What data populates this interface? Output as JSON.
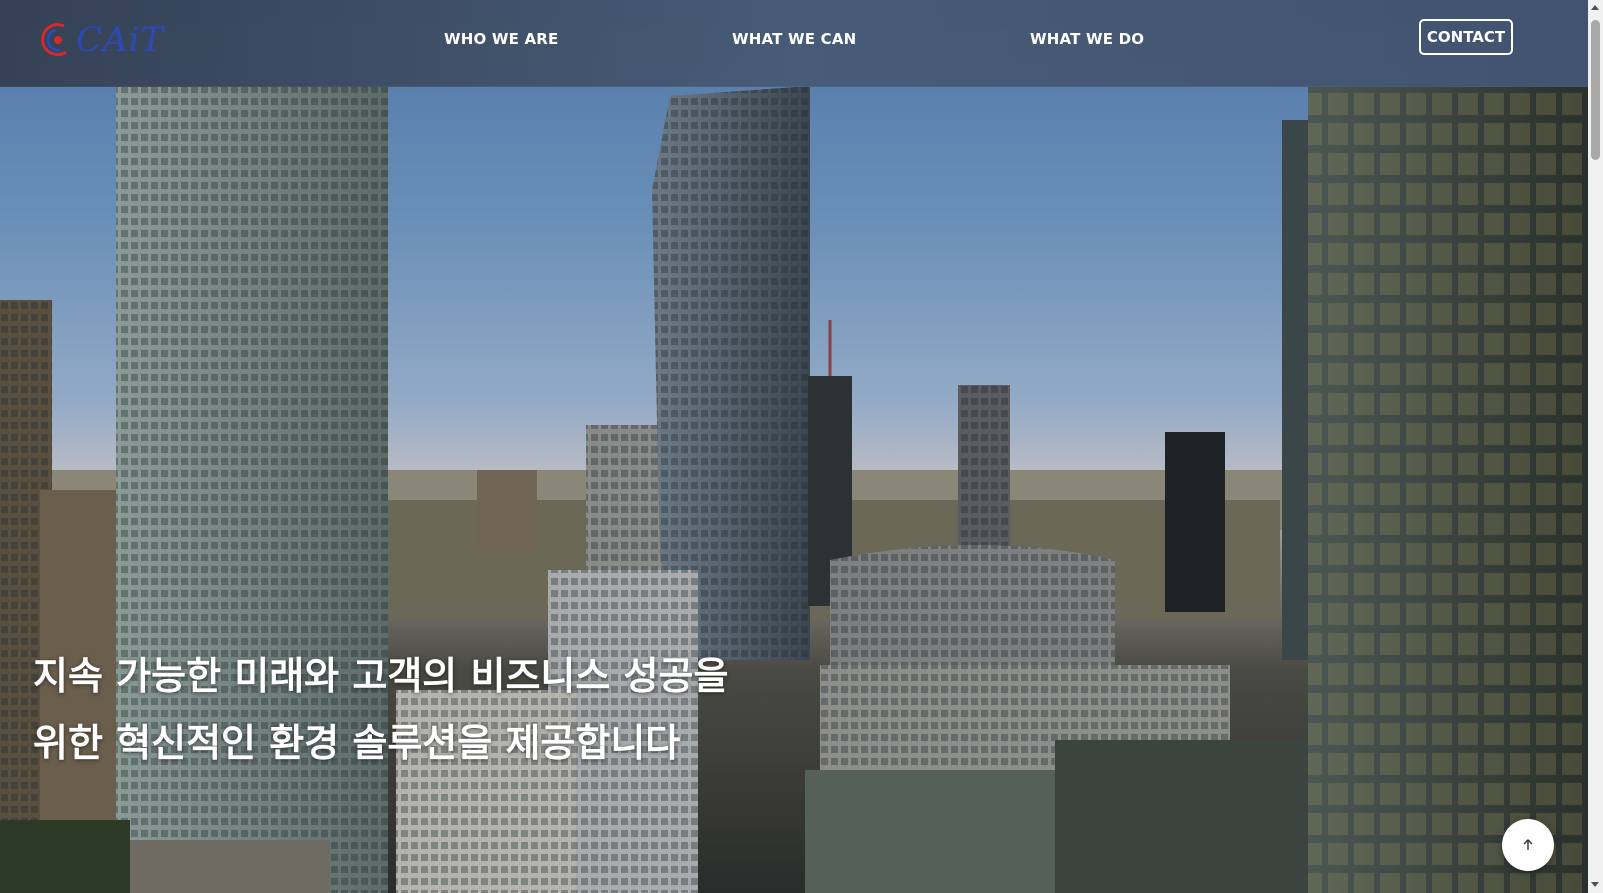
{
  "header": {
    "logo_text": "CAiT",
    "nav": [
      {
        "label": "WHO WE ARE"
      },
      {
        "label": "WHAT WE CAN"
      },
      {
        "label": "WHAT WE DO"
      }
    ],
    "contact_label": "CONTACT"
  },
  "hero": {
    "headline_line1": "지속 가능한 미래와 고객의 비즈니스 성공을",
    "headline_line2": "위한 혁신적인 환경 솔루션을 제공합니다"
  },
  "scroll_top": {
    "icon": "arrow-up-icon",
    "glyph": "↑"
  },
  "colors": {
    "header_bg": "#46587a",
    "text": "#ffffff",
    "logo_blue": "#2b4ab8",
    "logo_red": "#d62a2a"
  }
}
